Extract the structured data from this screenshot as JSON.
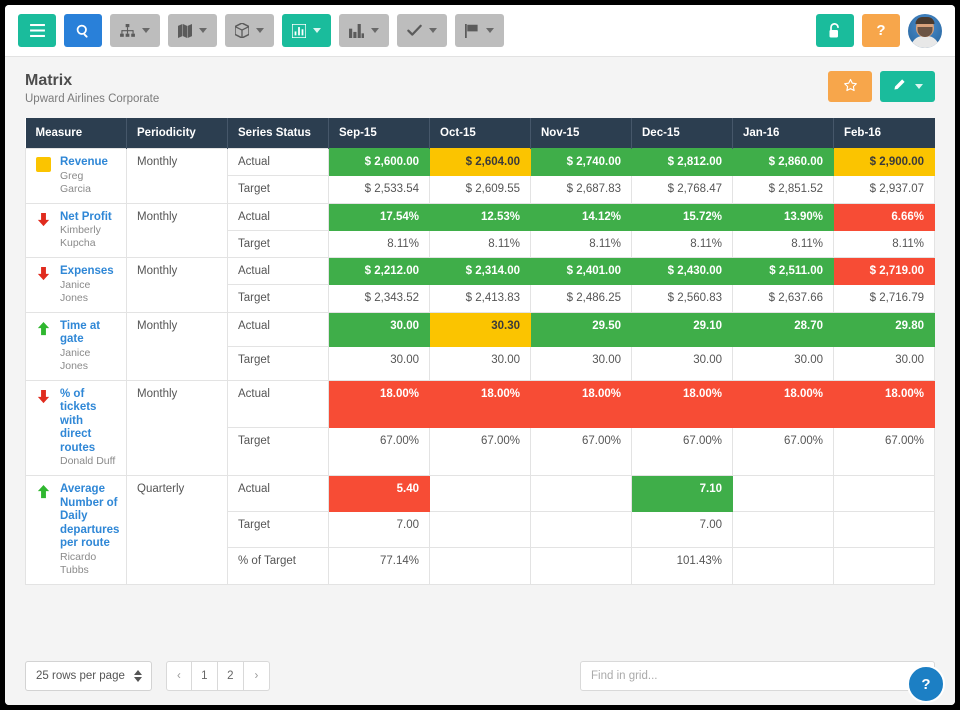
{
  "toolbar": {
    "buttons": [
      {
        "name": "menu-button",
        "icon": "hamburger-icon",
        "style": "green",
        "caret": false
      },
      {
        "name": "search-button",
        "icon": "search-icon",
        "style": "blue",
        "caret": false
      },
      {
        "name": "org-chart-button",
        "icon": "org-chart-icon",
        "style": "grey",
        "caret": true
      },
      {
        "name": "map-button",
        "icon": "map-icon",
        "style": "grey",
        "caret": true
      },
      {
        "name": "package-button",
        "icon": "cube-icon",
        "style": "grey",
        "caret": true
      },
      {
        "name": "charts-button",
        "icon": "bar-chart-icon",
        "style": "green",
        "caret": true
      },
      {
        "name": "reports-button",
        "icon": "chart-columns-icon",
        "style": "grey",
        "caret": true
      },
      {
        "name": "tasks-button",
        "icon": "check-icon",
        "style": "grey",
        "caret": true
      },
      {
        "name": "flags-button",
        "icon": "flag-icon",
        "style": "grey",
        "caret": true
      }
    ],
    "lock_button": {
      "name": "unlock-button",
      "icon": "unlock-icon"
    },
    "help_button": {
      "name": "help-button",
      "label": "?"
    },
    "avatar": {
      "name": "user-avatar"
    }
  },
  "header": {
    "title": "Matrix",
    "subtitle": "Upward Airlines Corporate",
    "favorite_button": {
      "icon": "star-icon"
    },
    "edit_button": {
      "icon": "pencil-icon"
    }
  },
  "grid": {
    "columns": [
      "Measure",
      "Periodicity",
      "Series Status",
      "Sep-15",
      "Oct-15",
      "Nov-15",
      "Dec-15",
      "Jan-16",
      "Feb-16"
    ],
    "periods": [
      "Sep-15",
      "Oct-15",
      "Nov-15",
      "Dec-15",
      "Jan-16",
      "Feb-16"
    ],
    "rows": [
      {
        "measure": "Revenue",
        "owner": "Greg Garcia",
        "indicator": "square-yellow",
        "periodicity": "Monthly",
        "series": [
          {
            "label": "Actual",
            "cells": [
              {
                "value": "$ 2,600.00",
                "status": "green"
              },
              {
                "value": "$ 2,604.00",
                "status": "yellow"
              },
              {
                "value": "$ 2,740.00",
                "status": "green"
              },
              {
                "value": "$ 2,812.00",
                "status": "green"
              },
              {
                "value": "$ 2,860.00",
                "status": "green"
              },
              {
                "value": "$ 2,900.00",
                "status": "yellow"
              }
            ]
          },
          {
            "label": "Target",
            "cells": [
              {
                "value": "$ 2,533.54",
                "status": "none"
              },
              {
                "value": "$ 2,609.55",
                "status": "none"
              },
              {
                "value": "$ 2,687.83",
                "status": "none"
              },
              {
                "value": "$ 2,768.47",
                "status": "none"
              },
              {
                "value": "$ 2,851.52",
                "status": "none"
              },
              {
                "value": "$ 2,937.07",
                "status": "none"
              }
            ]
          }
        ]
      },
      {
        "measure": "Net Profit",
        "owner": "Kimberly Kupcha",
        "indicator": "arrow-down-red",
        "periodicity": "Monthly",
        "series": [
          {
            "label": "Actual",
            "cells": [
              {
                "value": "17.54%",
                "status": "green"
              },
              {
                "value": "12.53%",
                "status": "green"
              },
              {
                "value": "14.12%",
                "status": "green"
              },
              {
                "value": "15.72%",
                "status": "green"
              },
              {
                "value": "13.90%",
                "status": "green"
              },
              {
                "value": "6.66%",
                "status": "red"
              }
            ]
          },
          {
            "label": "Target",
            "cells": [
              {
                "value": "8.11%",
                "status": "none"
              },
              {
                "value": "8.11%",
                "status": "none"
              },
              {
                "value": "8.11%",
                "status": "none"
              },
              {
                "value": "8.11%",
                "status": "none"
              },
              {
                "value": "8.11%",
                "status": "none"
              },
              {
                "value": "8.11%",
                "status": "none"
              }
            ]
          }
        ]
      },
      {
        "measure": "Expenses",
        "owner": "Janice Jones",
        "indicator": "arrow-down-red",
        "periodicity": "Monthly",
        "series": [
          {
            "label": "Actual",
            "cells": [
              {
                "value": "$ 2,212.00",
                "status": "green"
              },
              {
                "value": "$ 2,314.00",
                "status": "green"
              },
              {
                "value": "$ 2,401.00",
                "status": "green"
              },
              {
                "value": "$ 2,430.00",
                "status": "green"
              },
              {
                "value": "$ 2,511.00",
                "status": "green"
              },
              {
                "value": "$ 2,719.00",
                "status": "red"
              }
            ]
          },
          {
            "label": "Target",
            "cells": [
              {
                "value": "$ 2,343.52",
                "status": "none"
              },
              {
                "value": "$ 2,413.83",
                "status": "none"
              },
              {
                "value": "$ 2,486.25",
                "status": "none"
              },
              {
                "value": "$ 2,560.83",
                "status": "none"
              },
              {
                "value": "$ 2,637.66",
                "status": "none"
              },
              {
                "value": "$ 2,716.79",
                "status": "none"
              }
            ]
          }
        ]
      },
      {
        "measure": "Time at gate",
        "owner": "Janice Jones",
        "indicator": "arrow-up-green",
        "periodicity": "Monthly",
        "series": [
          {
            "label": "Actual",
            "cells": [
              {
                "value": "30.00",
                "status": "green"
              },
              {
                "value": "30.30",
                "status": "yellow"
              },
              {
                "value": "29.50",
                "status": "green"
              },
              {
                "value": "29.10",
                "status": "green"
              },
              {
                "value": "28.70",
                "status": "green"
              },
              {
                "value": "29.80",
                "status": "green"
              }
            ]
          },
          {
            "label": "Target",
            "cells": [
              {
                "value": "30.00",
                "status": "none"
              },
              {
                "value": "30.00",
                "status": "none"
              },
              {
                "value": "30.00",
                "status": "none"
              },
              {
                "value": "30.00",
                "status": "none"
              },
              {
                "value": "30.00",
                "status": "none"
              },
              {
                "value": "30.00",
                "status": "none"
              }
            ]
          }
        ]
      },
      {
        "measure": "% of tickets with direct routes",
        "owner": "Donald Duff",
        "indicator": "arrow-down-red",
        "periodicity": "Monthly",
        "series": [
          {
            "label": "Actual",
            "cells": [
              {
                "value": "18.00%",
                "status": "red"
              },
              {
                "value": "18.00%",
                "status": "red"
              },
              {
                "value": "18.00%",
                "status": "red"
              },
              {
                "value": "18.00%",
                "status": "red"
              },
              {
                "value": "18.00%",
                "status": "red"
              },
              {
                "value": "18.00%",
                "status": "red"
              }
            ]
          },
          {
            "label": "Target",
            "cells": [
              {
                "value": "67.00%",
                "status": "none"
              },
              {
                "value": "67.00%",
                "status": "none"
              },
              {
                "value": "67.00%",
                "status": "none"
              },
              {
                "value": "67.00%",
                "status": "none"
              },
              {
                "value": "67.00%",
                "status": "none"
              },
              {
                "value": "67.00%",
                "status": "none"
              }
            ]
          }
        ]
      },
      {
        "measure": "Average Number of Daily departures per route",
        "owner": "Ricardo Tubbs",
        "indicator": "arrow-up-green",
        "periodicity": "Quarterly",
        "series": [
          {
            "label": "Actual",
            "cells": [
              {
                "value": "5.40",
                "status": "red"
              },
              {
                "value": "",
                "status": "none"
              },
              {
                "value": "",
                "status": "none"
              },
              {
                "value": "7.10",
                "status": "green"
              },
              {
                "value": "",
                "status": "none"
              },
              {
                "value": "",
                "status": "none"
              }
            ]
          },
          {
            "label": "Target",
            "cells": [
              {
                "value": "7.00",
                "status": "none"
              },
              {
                "value": "",
                "status": "none"
              },
              {
                "value": "",
                "status": "none"
              },
              {
                "value": "7.00",
                "status": "none"
              },
              {
                "value": "",
                "status": "none"
              },
              {
                "value": "",
                "status": "none"
              }
            ]
          },
          {
            "label": "% of Target",
            "cells": [
              {
                "value": "77.14%",
                "status": "none"
              },
              {
                "value": "",
                "status": "none"
              },
              {
                "value": "",
                "status": "none"
              },
              {
                "value": "101.43%",
                "status": "none"
              },
              {
                "value": "",
                "status": "none"
              },
              {
                "value": "",
                "status": "none"
              }
            ]
          }
        ]
      }
    ]
  },
  "footer": {
    "rows_per_page": "25 rows per page",
    "pager": [
      "‹",
      "1",
      "2",
      "›"
    ],
    "search_placeholder": "Find in grid...",
    "search_value": "",
    "help_bubble": "?"
  },
  "colors": {
    "green": "#3fae49",
    "red": "#f74c35",
    "yellow": "#fbc400",
    "header": "#2c3e50",
    "link": "#2f87d6",
    "accent_green": "#1abc9c",
    "accent_blue": "#2980d9",
    "accent_orange": "#f7a64b"
  }
}
